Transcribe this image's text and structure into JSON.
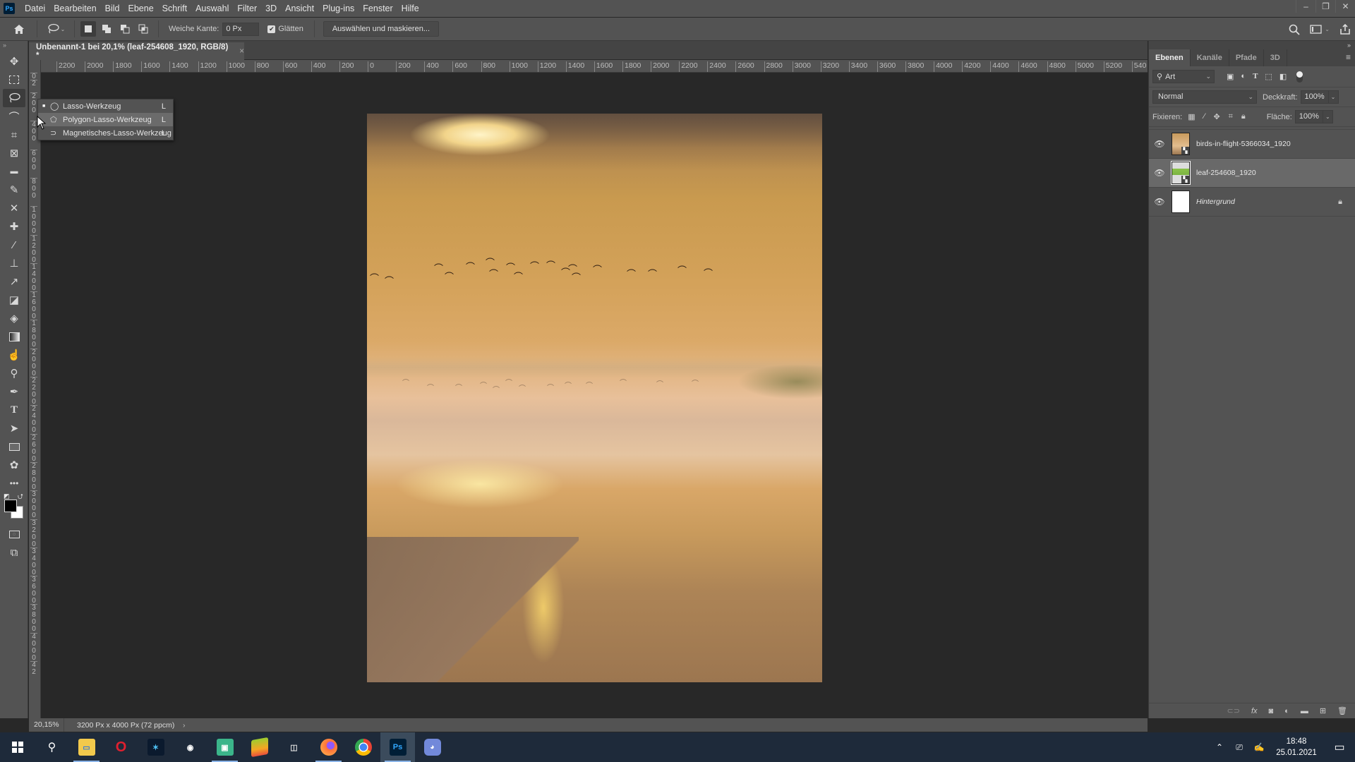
{
  "app": {
    "logo": "Ps"
  },
  "menubar": {
    "items": [
      "Datei",
      "Bearbeiten",
      "Bild",
      "Ebene",
      "Schrift",
      "Auswahl",
      "Filter",
      "3D",
      "Ansicht",
      "Plug-ins",
      "Fenster",
      "Hilfe"
    ],
    "window_controls": {
      "minimize": "–",
      "restore": "❐",
      "close": "✕"
    }
  },
  "options_bar": {
    "feather_label": "Weiche Kante:",
    "feather_value": "0 Px",
    "antialias_label": "Glätten",
    "antialias_checked": true,
    "select_mask_button": "Auswählen und maskieren..."
  },
  "document": {
    "tab_title": "Unbenannt-1 bei 20,1% (leaf-254608_1920, RGB/8) *",
    "close": "×",
    "h_ruler_ticks": [
      "2200",
      "2000",
      "1800",
      "1600",
      "1400",
      "1200",
      "1000",
      "800",
      "600",
      "400",
      "200",
      "0",
      "200",
      "400",
      "600",
      "800",
      "1000",
      "1200",
      "1400",
      "1600",
      "1800",
      "2000",
      "2200",
      "2400",
      "2600",
      "2800",
      "3000",
      "3200",
      "3400",
      "3600",
      "3800",
      "4000",
      "4200",
      "4400",
      "4600",
      "4800",
      "5000",
      "5200",
      "540"
    ],
    "v_ruler_ticks": [
      "0",
      "2",
      "200",
      "400",
      "600",
      "800",
      "1000",
      "1200",
      "1400",
      "1600",
      "1800",
      "2000",
      "2200",
      "2400",
      "2600",
      "2800",
      "3000",
      "3200",
      "3400",
      "3600",
      "3800",
      "4000",
      "42"
    ]
  },
  "tool_flyout": {
    "items": [
      {
        "label": "Lasso-Werkzeug",
        "key": "L",
        "current": true
      },
      {
        "label": "Polygon-Lasso-Werkzeug",
        "key": "L",
        "hovered": true
      },
      {
        "label": "Magnetisches-Lasso-Werkzeug",
        "key": "L"
      }
    ]
  },
  "status": {
    "zoom": "20,15%",
    "doc_info": "3200 Px x 4000 Px (72 ppcm)",
    "arrow": "›"
  },
  "layers_panel": {
    "tabs": [
      "Ebenen",
      "Kanäle",
      "Pfade",
      "3D"
    ],
    "active_tab": "Ebenen",
    "filter_label": "Art",
    "blend_mode": "Normal",
    "opacity_label": "Deckkraft:",
    "opacity_value": "100%",
    "lock_label": "Fixieren:",
    "fill_label": "Fläche:",
    "fill_value": "100%",
    "layers": [
      {
        "name": "birds-in-flight-5366034_1920",
        "visible": true,
        "selected": false,
        "smart_object": true
      },
      {
        "name": "leaf-254608_1920",
        "visible": true,
        "selected": true,
        "smart_object": true
      },
      {
        "name": "Hintergrund",
        "visible": true,
        "selected": false,
        "locked": true
      }
    ]
  },
  "taskbar": {
    "apps": [
      "start",
      "search",
      "file-explorer",
      "opera",
      "app-blue",
      "app-circle",
      "app-green",
      "bluestacks",
      "app-owl",
      "firefox",
      "chrome",
      "photoshop",
      "discord"
    ],
    "time": "18:48",
    "date": "25.01.2021"
  },
  "colors": {
    "foreground": "#000000",
    "background": "#ffffff",
    "accent": "#31a8ff"
  }
}
